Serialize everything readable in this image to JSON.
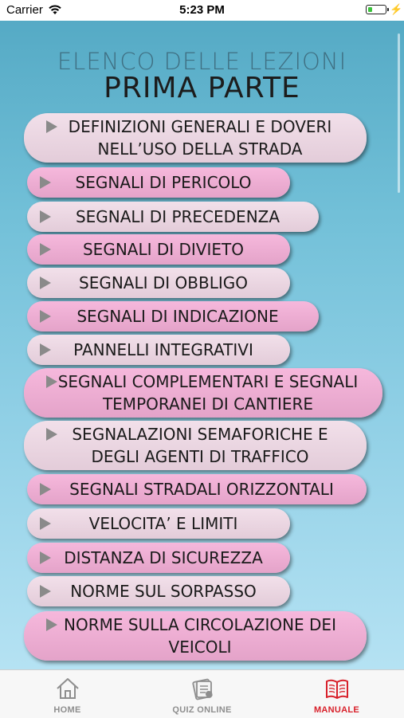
{
  "status_bar": {
    "carrier": "Carrier",
    "time": "5:23 PM",
    "battery_level": 0.25,
    "battery_color": "#3cc33c"
  },
  "header": {
    "subtitle": "ELENCO DELLE LEZIONI",
    "title": "PRIMA PARTE"
  },
  "lessons": [
    {
      "label": "DEFINIZIONI GENERALI E DOVERI NELL’USO DELLA STRADA",
      "style": "light"
    },
    {
      "label": "SEGNALI DI PERICOLO",
      "style": "pink"
    },
    {
      "label": "SEGNALI DI PRECEDENZA",
      "style": "light"
    },
    {
      "label": "SEGNALI DI DIVIETO",
      "style": "pink"
    },
    {
      "label": "SEGNALI DI OBBLIGO",
      "style": "light"
    },
    {
      "label": "SEGNALI DI INDICAZIONE",
      "style": "pink"
    },
    {
      "label": "PANNELLI INTEGRATIVI",
      "style": "light"
    },
    {
      "label": "SEGNALI COMPLEMENTARI E SEGNALI TEMPORANEI DI CANTIERE",
      "style": "pink"
    },
    {
      "label": "SEGNALAZIONI SEMAFORICHE E DEGLI AGENTI DI TRAFFICO",
      "style": "light"
    },
    {
      "label": "SEGNALI STRADALI ORIZZONTALI",
      "style": "pink"
    },
    {
      "label": "VELOCITA’ E LIMITI",
      "style": "light"
    },
    {
      "label": "DISTANZA DI SICUREZZA",
      "style": "pink"
    },
    {
      "label": "NORME SUL SORPASSO",
      "style": "light"
    },
    {
      "label": "NORME SULLA CIRCOLAZIONE DEI VEICOLI",
      "style": "pink"
    }
  ],
  "tabs": [
    {
      "label": "HOME",
      "icon": "home-icon",
      "active": false
    },
    {
      "label": "QUIZ ONLINE",
      "icon": "quiz-icon",
      "active": false
    },
    {
      "label": "MANUALE",
      "icon": "book-icon",
      "active": true
    }
  ],
  "colors": {
    "accent_active_tab": "#d8202a",
    "pink_button": "#eeadd3",
    "light_button": "#ecd8e3",
    "background_top": "#55aac5",
    "background_bottom": "#b5e2f3"
  }
}
